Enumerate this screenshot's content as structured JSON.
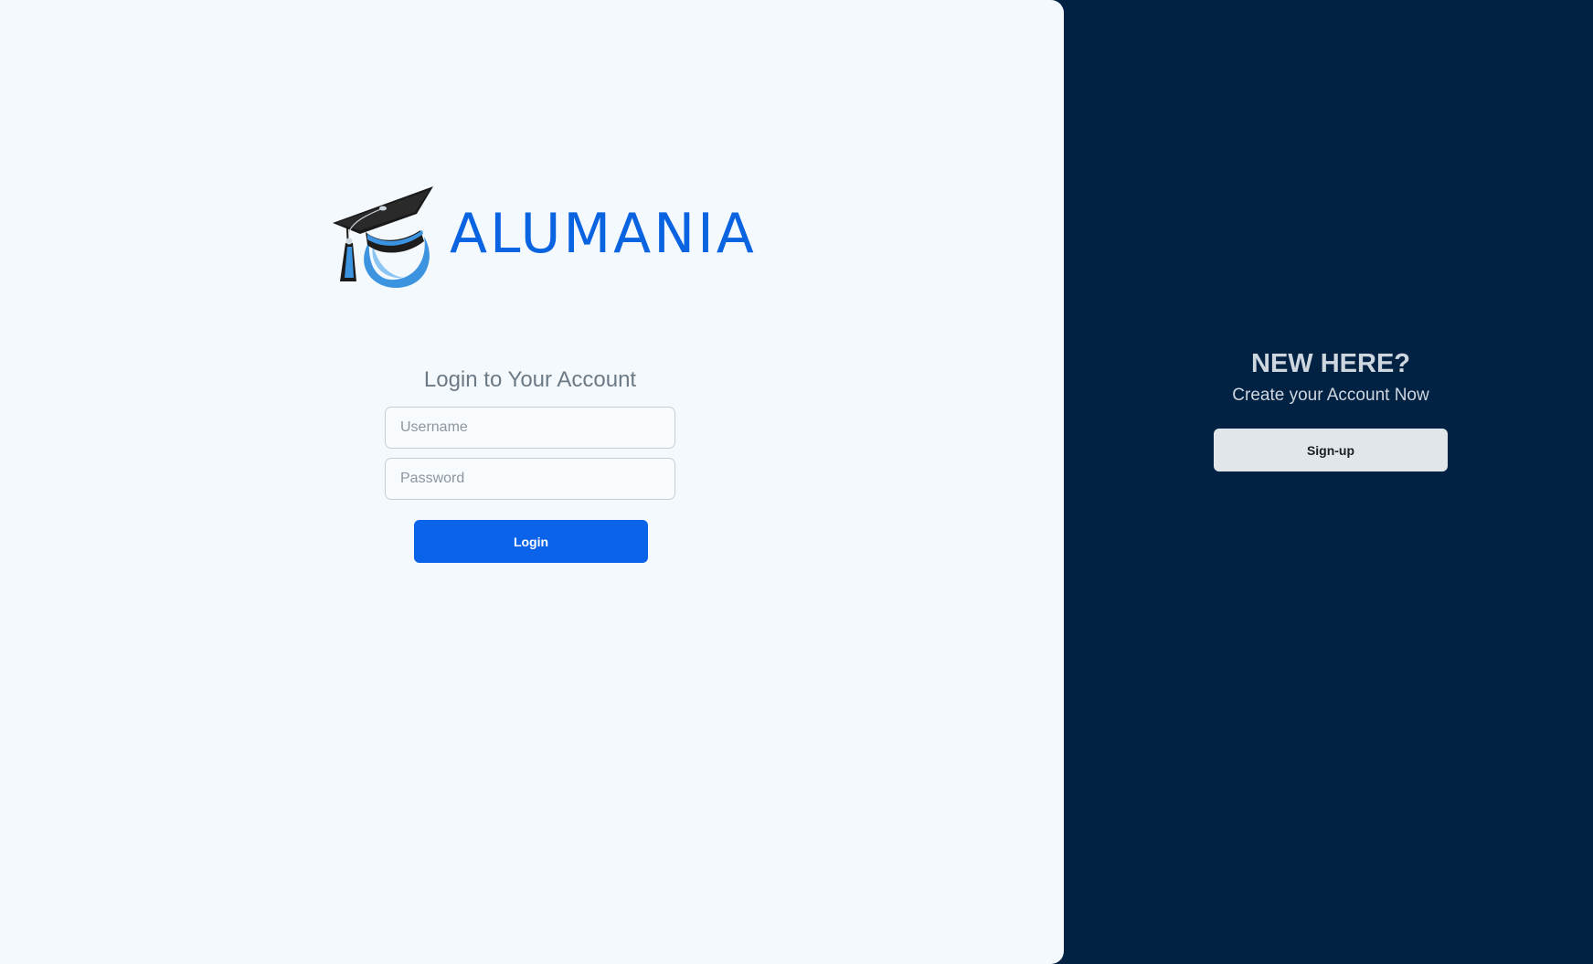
{
  "brand": {
    "name": "ALUMANIA",
    "logo_icon": "graduation-cap-icon",
    "color": "#0a63e0"
  },
  "login": {
    "title": "Login to Your Account",
    "username_placeholder": "Username",
    "username_value": "",
    "password_placeholder": "Password",
    "password_value": "",
    "button_label": "Login",
    "button_color": "#0a63e9"
  },
  "signup": {
    "heading": "NEW HERE?",
    "subheading": "Create your Account Now",
    "button_label": "Sign-up",
    "panel_color": "#022244"
  }
}
